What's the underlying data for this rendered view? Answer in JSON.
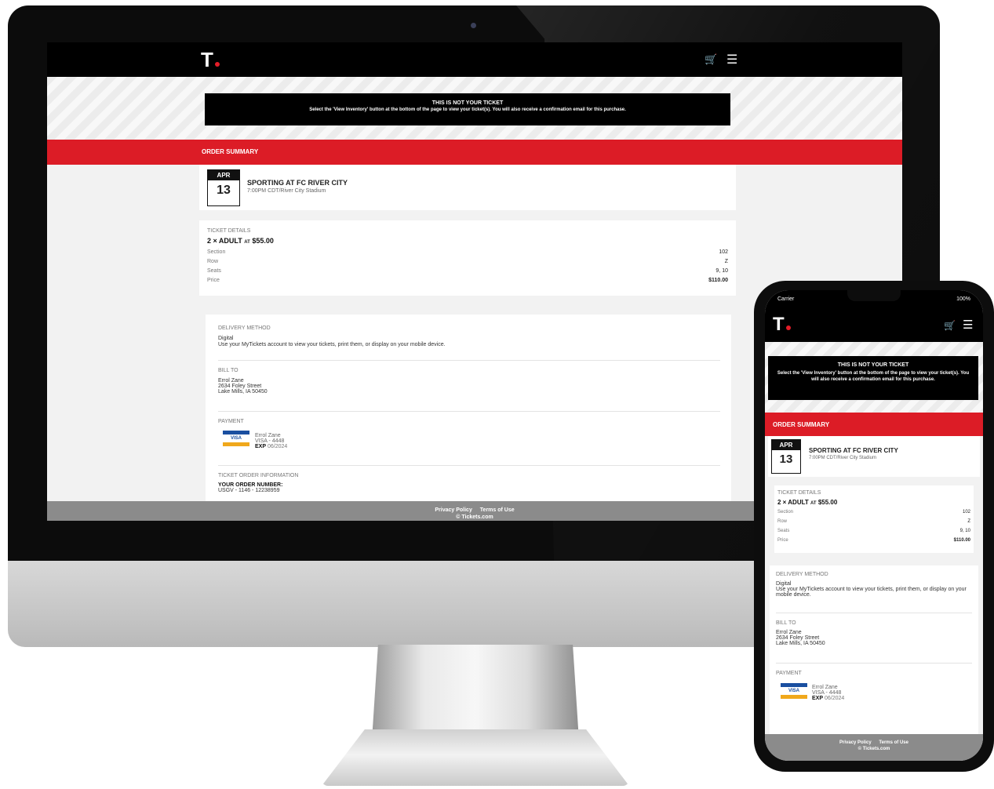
{
  "site": {
    "logo": "T",
    "cart_icon": "cart-icon",
    "menu_icon": "menu-icon",
    "notice_title": "THIS IS NOT YOUR TICKET",
    "notice_text": "Select the 'View Inventory' button at the bottom of the page to view your ticket(s). You will also receive a confirmation email for this purchase.",
    "band_title": "ORDER SUMMARY",
    "accent_color": "#dc1c26"
  },
  "event": {
    "month": "APR",
    "day": "13",
    "title": "SPORTING AT FC RIVER CITY",
    "subtitle": "7:00PM CDT/River City Stadium"
  },
  "ticket_details": {
    "label": "TICKET DETAILS",
    "summary_qty": "2 × ADULT",
    "summary_at": "AT",
    "summary_price": "$55.00",
    "rows": [
      {
        "key": "Section",
        "value": "102"
      },
      {
        "key": "Row",
        "value": "Z"
      },
      {
        "key": "Seats",
        "value": "9, 10"
      },
      {
        "key": "Price",
        "value": "$110.00"
      }
    ]
  },
  "delivery": {
    "label": "DELIVERY METHOD",
    "method": "Digital",
    "text": "Use your MyTickets account to view your tickets, print them, or display on your mobile device."
  },
  "bill_to": {
    "label": "BILL TO",
    "name": "Errol Zane",
    "street": "2634 Foley Street",
    "city": "Lake Mills, IA 50450"
  },
  "payment": {
    "label": "PAYMENT",
    "card_brand": "VISA",
    "name": "Errol Zane",
    "card": "VISA - 4448",
    "exp_label": "EXP",
    "exp_value": "06/2024"
  },
  "order": {
    "label": "TICKET ORDER INFORMATION",
    "number_label": "YOUR ORDER NUMBER:",
    "number": "USGV - 1146 - 12238959"
  },
  "footer": {
    "privacy": "Privacy Policy",
    "terms": "Terms of Use",
    "copyright": "© Tickets.com"
  },
  "phone_status": {
    "carrier": "Carrier",
    "battery": "100%"
  }
}
